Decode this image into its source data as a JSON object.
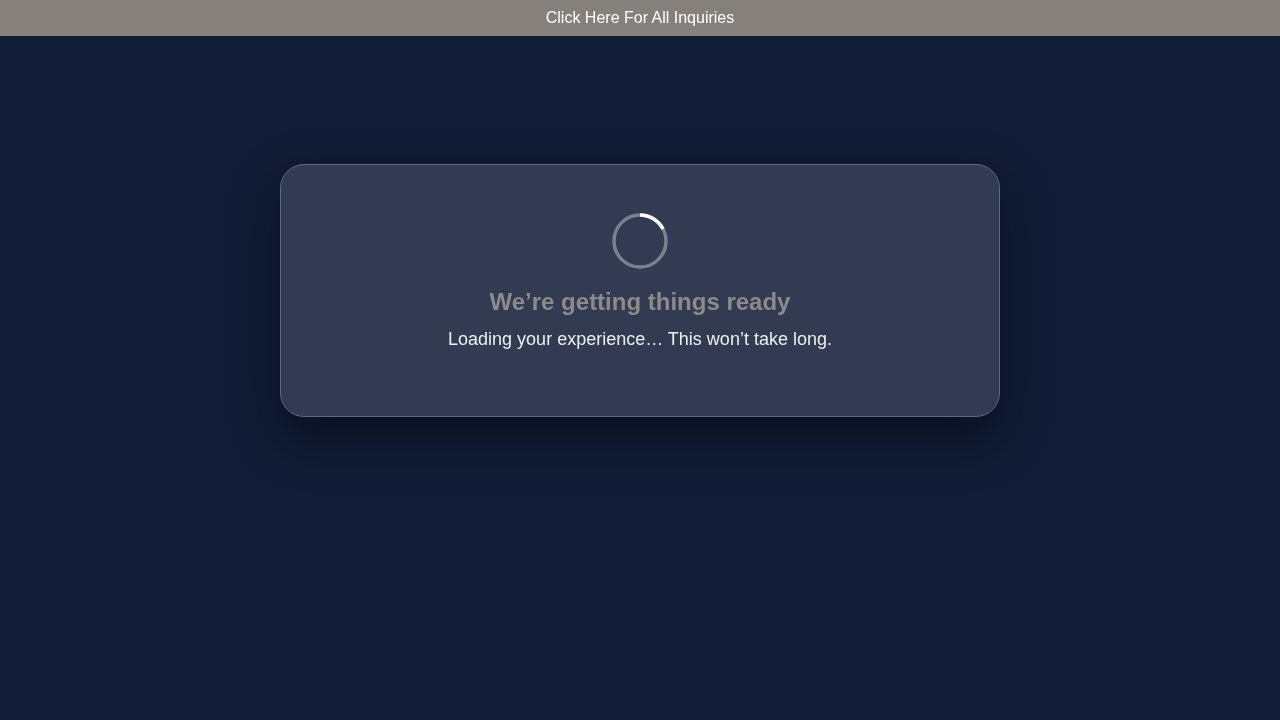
{
  "top_bar": {
    "link": "Click Here For All Inquiries"
  },
  "card": {
    "title": "We’re getting things ready",
    "message": "Loading your experience… This won’t take long."
  }
}
